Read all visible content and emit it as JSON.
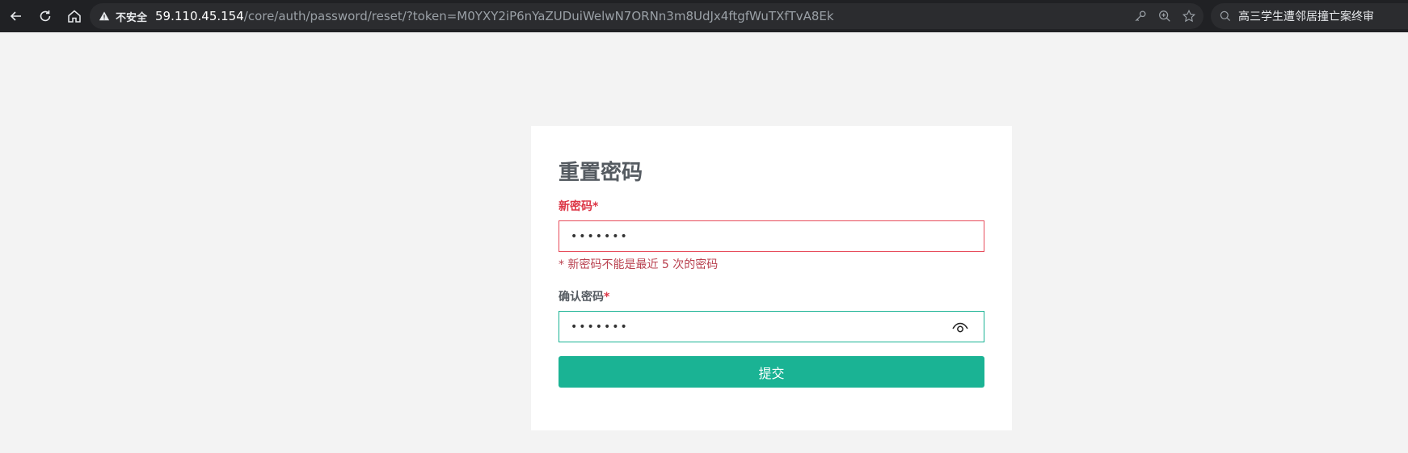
{
  "browser": {
    "insecure_label": "不安全",
    "url_host": "59.110.45.154",
    "url_path": "/core/auth/password/reset/?token=M0YXY2iP6nYaZUDuiWelwN7ORNn3m8UdJx4ftgfWuTXfTvA8Ek",
    "search_text": "高三学生遭邻居撞亡案终审",
    "icons": [
      "back-icon",
      "reload-icon",
      "home-icon",
      "warning-icon",
      "key-icon",
      "zoom-icon",
      "star-icon",
      "search-icon"
    ]
  },
  "form": {
    "title": "重置密码",
    "new_password": {
      "label": "新密码",
      "required_mark": "*",
      "value": "•••••••",
      "error": "* 新密码不能是最近 5 次的密码"
    },
    "confirm_password": {
      "label": "确认密码",
      "required_mark": "*",
      "value": "•••••••"
    },
    "submit_label": "提交"
  },
  "colors": {
    "accent": "#1ab394",
    "error": "#dc3545",
    "chrome_bg": "#202124",
    "page_bg": "#f3f3f3"
  }
}
